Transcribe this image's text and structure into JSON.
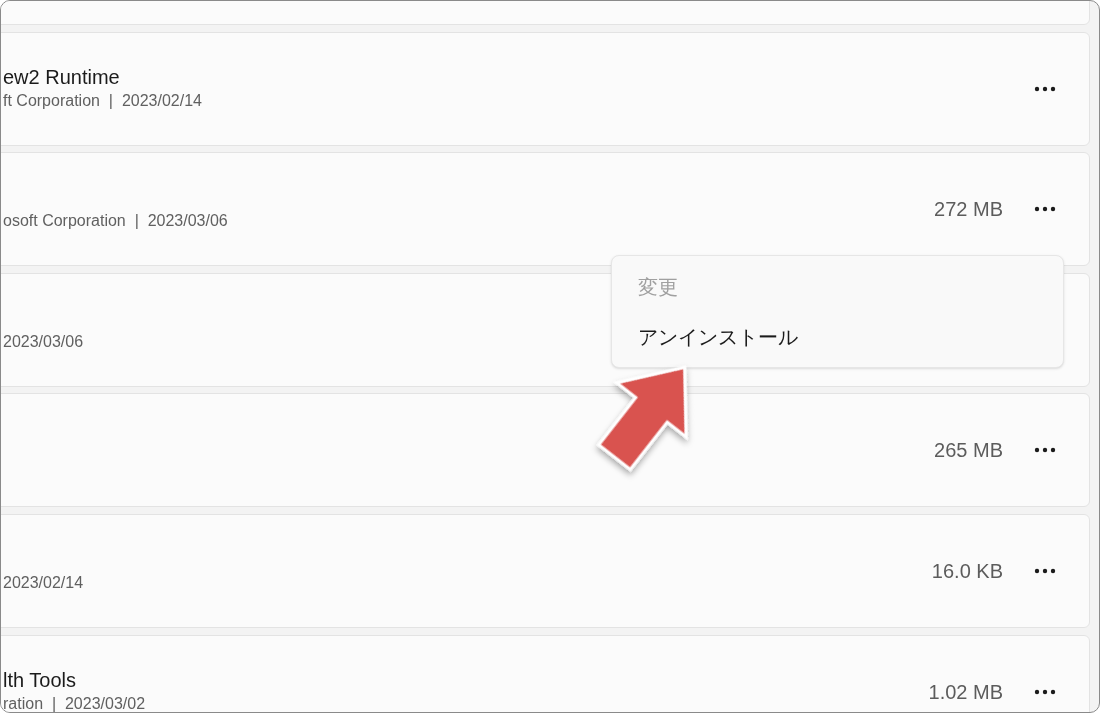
{
  "apps": [
    {
      "title": "ew2 Runtime",
      "detail": "ft Corporation  |  2023/02/14"
    },
    {
      "detail": "osoft Corporation  |  2023/03/06",
      "size": "272 MB"
    },
    {
      "detail": "2023/03/06"
    },
    {
      "size": "265 MB"
    },
    {
      "detail": "2023/02/14",
      "size": "16.0 KB"
    },
    {
      "title": "lth Tools",
      "detail": "ration  |  2023/03/02",
      "size": "1.02 MB"
    }
  ],
  "context_menu": {
    "items": [
      {
        "label": "変更",
        "disabled": true
      },
      {
        "label": "アンインストール",
        "disabled": false
      }
    ]
  }
}
